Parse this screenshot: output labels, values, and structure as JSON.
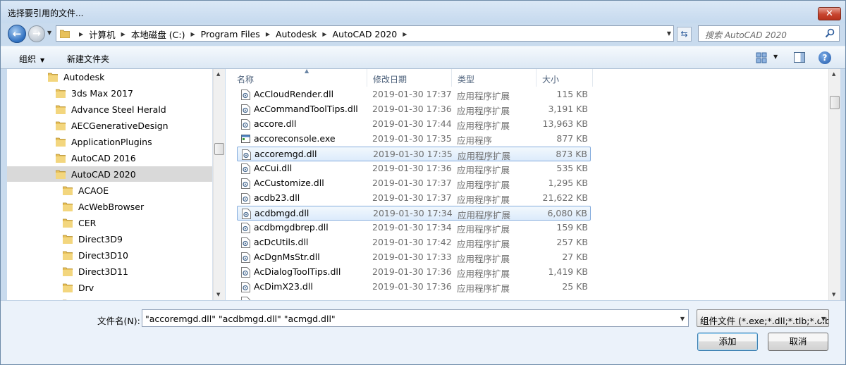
{
  "window": {
    "title": "选择要引用的文件...",
    "close_label": "✕"
  },
  "nav": {
    "breadcrumbs": [
      "计算机",
      "本地磁盘 (C:)",
      "Program Files",
      "Autodesk",
      "AutoCAD 2020"
    ],
    "search_placeholder": "搜索 AutoCAD 2020"
  },
  "toolbar": {
    "organize_label": "组织",
    "new_folder_label": "新建文件夹"
  },
  "tree": {
    "items": [
      {
        "label": "Autodesk",
        "level": 0,
        "selected": false
      },
      {
        "label": "3ds Max 2017",
        "level": 1,
        "selected": false
      },
      {
        "label": "Advance Steel Herald",
        "level": 1,
        "selected": false
      },
      {
        "label": "AECGenerativeDesign",
        "level": 1,
        "selected": false
      },
      {
        "label": "ApplicationPlugins",
        "level": 1,
        "selected": false
      },
      {
        "label": "AutoCAD 2016",
        "level": 1,
        "selected": false
      },
      {
        "label": "AutoCAD 2020",
        "level": 1,
        "selected": true
      },
      {
        "label": "ACAOE",
        "level": 2,
        "selected": false
      },
      {
        "label": "AcWebBrowser",
        "level": 2,
        "selected": false
      },
      {
        "label": "CER",
        "level": 2,
        "selected": false
      },
      {
        "label": "Direct3D9",
        "level": 2,
        "selected": false
      },
      {
        "label": "Direct3D10",
        "level": 2,
        "selected": false
      },
      {
        "label": "Direct3D11",
        "level": 2,
        "selected": false
      },
      {
        "label": "Drv",
        "level": 2,
        "selected": false
      },
      {
        "label": "",
        "level": 2,
        "selected": false
      }
    ]
  },
  "filelist": {
    "columns": {
      "name": "名称",
      "date": "修改日期",
      "type": "类型",
      "size": "大小"
    },
    "rows": [
      {
        "name": "AcCloudRender.dll",
        "date": "2019-01-30 17:37",
        "type": "应用程序扩展",
        "size": "115 KB",
        "icon": "dll-icon",
        "selected": false
      },
      {
        "name": "AcCommandToolTips.dll",
        "date": "2019-01-30 17:36",
        "type": "应用程序扩展",
        "size": "3,191 KB",
        "icon": "dll-icon",
        "selected": false
      },
      {
        "name": "accore.dll",
        "date": "2019-01-30 17:44",
        "type": "应用程序扩展",
        "size": "13,963 KB",
        "icon": "dll-icon",
        "selected": false
      },
      {
        "name": "accoreconsole.exe",
        "date": "2019-01-30 17:35",
        "type": "应用程序",
        "size": "877 KB",
        "icon": "exe-icon",
        "selected": false
      },
      {
        "name": "accoremgd.dll",
        "date": "2019-01-30 17:35",
        "type": "应用程序扩展",
        "size": "873 KB",
        "icon": "dll-icon",
        "selected": true
      },
      {
        "name": "AcCui.dll",
        "date": "2019-01-30 17:36",
        "type": "应用程序扩展",
        "size": "535 KB",
        "icon": "dll-icon",
        "selected": false
      },
      {
        "name": "AcCustomize.dll",
        "date": "2019-01-30 17:37",
        "type": "应用程序扩展",
        "size": "1,295 KB",
        "icon": "dll-icon",
        "selected": false
      },
      {
        "name": "acdb23.dll",
        "date": "2019-01-30 17:37",
        "type": "应用程序扩展",
        "size": "21,622 KB",
        "icon": "dll-icon",
        "selected": false
      },
      {
        "name": "acdbmgd.dll",
        "date": "2019-01-30 17:34",
        "type": "应用程序扩展",
        "size": "6,080 KB",
        "icon": "dll-icon",
        "selected": true
      },
      {
        "name": "acdbmgdbrep.dll",
        "date": "2019-01-30 17:34",
        "type": "应用程序扩展",
        "size": "159 KB",
        "icon": "dll-icon",
        "selected": false
      },
      {
        "name": "acDcUtils.dll",
        "date": "2019-01-30 17:42",
        "type": "应用程序扩展",
        "size": "257 KB",
        "icon": "dll-icon",
        "selected": false
      },
      {
        "name": "AcDgnMsStr.dll",
        "date": "2019-01-30 17:33",
        "type": "应用程序扩展",
        "size": "27 KB",
        "icon": "dll-icon",
        "selected": false
      },
      {
        "name": "AcDialogToolTips.dll",
        "date": "2019-01-30 17:36",
        "type": "应用程序扩展",
        "size": "1,419 KB",
        "icon": "dll-icon",
        "selected": false
      },
      {
        "name": "AcDimX23.dll",
        "date": "2019-01-30 17:36",
        "type": "应用程序扩展",
        "size": "25 KB",
        "icon": "dll-icon",
        "selected": false
      },
      {
        "name": "",
        "date": "",
        "type": "",
        "size": "",
        "icon": "dll-icon",
        "selected": false
      }
    ]
  },
  "bottom": {
    "filename_label": "文件名(N):",
    "filename_value": "\"accoremgd.dll\" \"acdbmgd.dll\" \"acmgd.dll\"",
    "filetype_value": "组件文件 (*.exe;*.dll;*.tlb;*.olb",
    "add_label": "添加",
    "cancel_label": "取消"
  },
  "colors": {
    "accent": "#2e6fc0",
    "selection_border": "#84acdd",
    "folder": "#e8c15a"
  }
}
